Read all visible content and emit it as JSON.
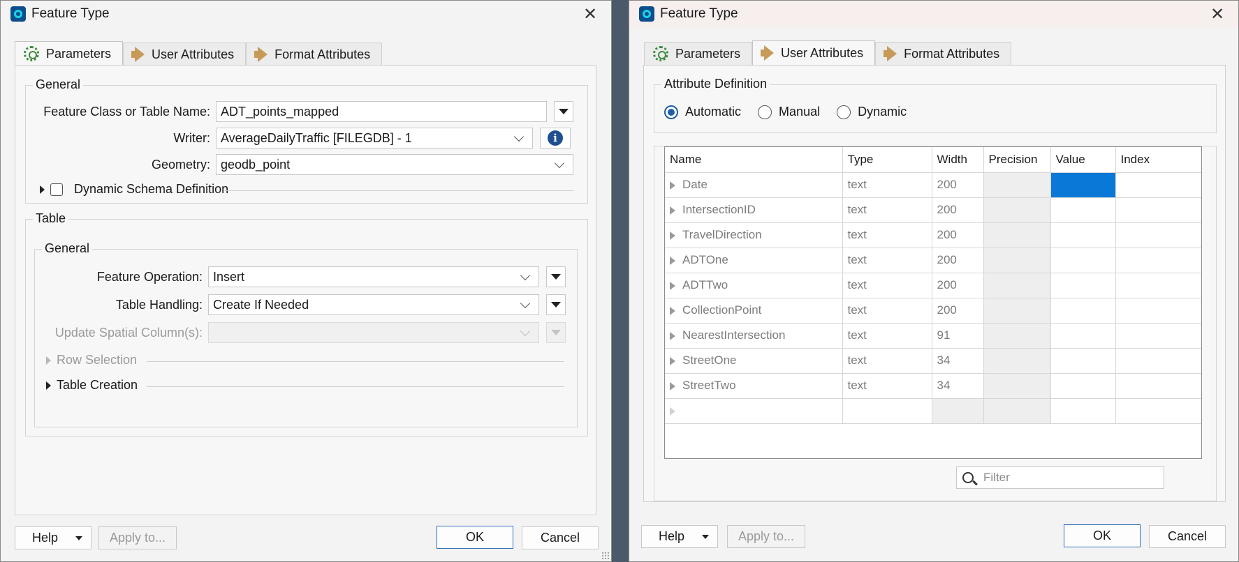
{
  "left": {
    "title": "Feature Type",
    "tabs": [
      {
        "label": "Parameters"
      },
      {
        "label": "User Attributes"
      },
      {
        "label": "Format Attributes"
      }
    ],
    "general": {
      "legend": "General",
      "feature_class_label": "Feature Class or Table Name:",
      "feature_class_value": "ADT_points_mapped",
      "writer_label": "Writer:",
      "writer_value": "AverageDailyTraffic [FILEGDB] - 1",
      "geometry_label": "Geometry:",
      "geometry_value": "geodb_point",
      "dynamic_schema_label": "Dynamic Schema Definition"
    },
    "table": {
      "legend": "Table",
      "sub_legend": "General",
      "feature_operation_label": "Feature Operation:",
      "feature_operation_value": "Insert",
      "table_handling_label": "Table Handling:",
      "table_handling_value": "Create If Needed",
      "update_spatial_label": "Update Spatial Column(s):",
      "update_spatial_value": "",
      "row_selection_label": "Row Selection",
      "table_creation_label": "Table Creation"
    },
    "buttons": {
      "help": "Help",
      "apply": "Apply to...",
      "ok": "OK",
      "cancel": "Cancel"
    }
  },
  "right": {
    "title": "Feature Type",
    "tabs": [
      {
        "label": "Parameters"
      },
      {
        "label": "User Attributes"
      },
      {
        "label": "Format Attributes"
      }
    ],
    "attr_def": {
      "legend": "Attribute Definition",
      "options": [
        "Automatic",
        "Manual",
        "Dynamic"
      ],
      "selected": "Automatic"
    },
    "table": {
      "columns": [
        "Name",
        "Type",
        "Width",
        "Precision",
        "Value",
        "Index"
      ],
      "rows": [
        {
          "name": "Date",
          "type": "text",
          "width": "200"
        },
        {
          "name": "IntersectionID",
          "type": "text",
          "width": "200"
        },
        {
          "name": "TravelDirection",
          "type": "text",
          "width": "200"
        },
        {
          "name": "ADTOne",
          "type": "text",
          "width": "200"
        },
        {
          "name": "ADTTwo",
          "type": "text",
          "width": "200"
        },
        {
          "name": "CollectionPoint",
          "type": "text",
          "width": "200"
        },
        {
          "name": "NearestIntersection",
          "type": "text",
          "width": "91"
        },
        {
          "name": "StreetOne",
          "type": "text",
          "width": "34"
        },
        {
          "name": "StreetTwo",
          "type": "text",
          "width": "34"
        }
      ]
    },
    "filter_placeholder": "Filter",
    "buttons": {
      "help": "Help",
      "apply": "Apply to...",
      "ok": "OK",
      "cancel": "Cancel"
    }
  },
  "colors": {
    "accent": "#0a78d7",
    "primary_border": "#2f6fb8"
  }
}
